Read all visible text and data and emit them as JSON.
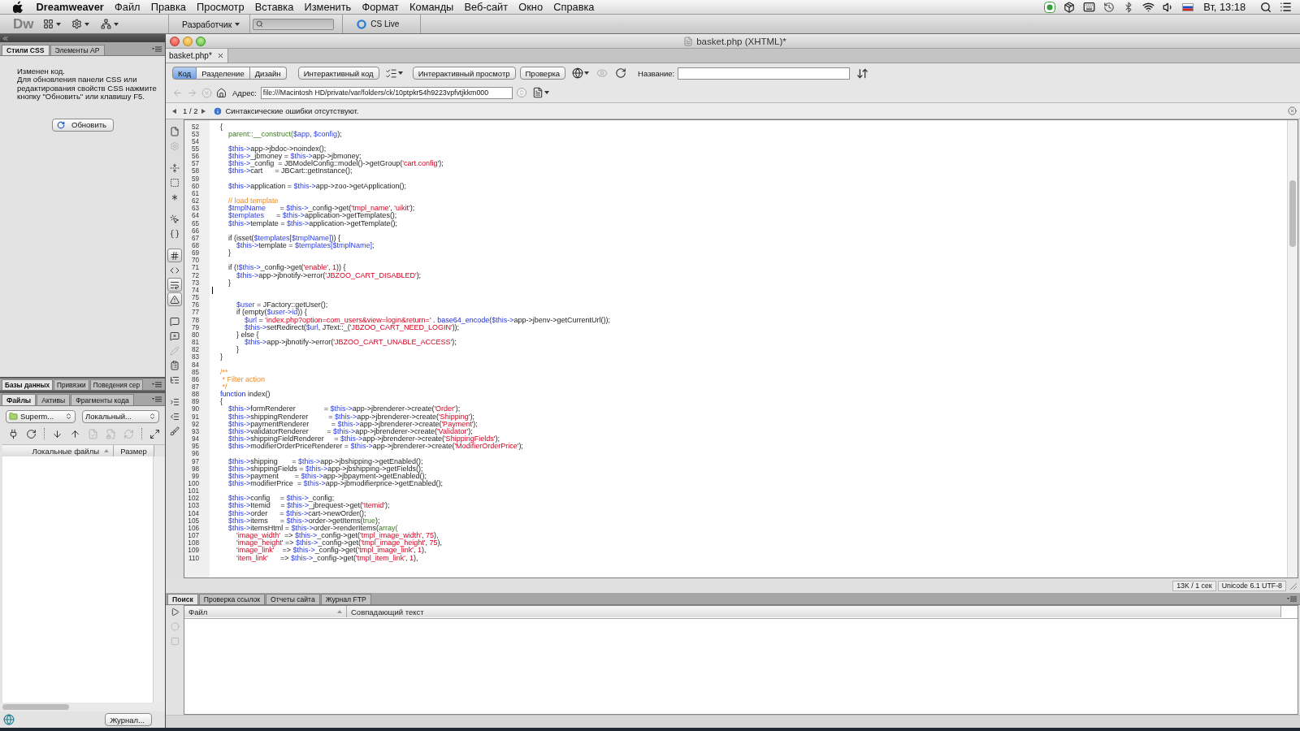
{
  "menu_bar": {
    "app_name": "Dreamweaver",
    "items": [
      "Файл",
      "Правка",
      "Просмотр",
      "Вставка",
      "Изменить",
      "Формат",
      "Команды",
      "Веб-сайт",
      "Окно",
      "Справка"
    ],
    "clock": "Вт, 13:18"
  },
  "app_bar": {
    "logo": "Dw",
    "workspace": "Разработчик",
    "cs_live": "CS Live"
  },
  "css_panel": {
    "tabs": [
      {
        "label": "Стили CSS",
        "selected": true
      },
      {
        "label": "Элементы AP",
        "selected": false
      }
    ],
    "status": "Изменен код.",
    "message": "Для обновления панели CSS или редактирования свойств CSS нажмите кнопку \"Обновить\" или клавишу F5.",
    "refresh_button": "Обновить"
  },
  "data_panel": {
    "tabs": [
      {
        "label": "Базы данных",
        "selected": true
      },
      {
        "label": "Привязки",
        "selected": false
      },
      {
        "label": "Поведения сер",
        "selected": false
      }
    ]
  },
  "files_panel": {
    "tabs": [
      {
        "label": "Файлы",
        "selected": true
      },
      {
        "label": "Активы",
        "selected": false
      },
      {
        "label": "Фрагменты кода",
        "selected": false
      }
    ],
    "site": "Superm...",
    "view": "Локальный...",
    "tools": [
      {
        "disabled": false
      },
      {
        "disabled": false
      },
      {
        "disabled": false
      },
      {
        "disabled": false
      },
      {
        "disabled": true
      },
      {
        "disabled": true
      },
      {
        "disabled": true
      },
      {
        "disabled": false
      }
    ],
    "columns": [
      {
        "label": "Локальные файлы",
        "sorted": true
      },
      {
        "label": "Размер",
        "sorted": false
      }
    ],
    "log_button": "Журнал..."
  },
  "document": {
    "title": "basket.php (XHTML)*",
    "tab": "basket.php*",
    "views": [
      {
        "label": "Код",
        "selected": true
      },
      {
        "label": "Разделение",
        "selected": false
      },
      {
        "label": "Дизайн",
        "selected": false
      }
    ],
    "live_code_button": "Интерактивный код",
    "live_view_button": "Интерактивный просмотр",
    "inspect_button": "Проверка",
    "preview_tools": [
      {
        "disabled": false
      },
      {
        "disabled": true
      },
      {
        "disabled": false
      }
    ],
    "title_label": "Название:",
    "nav_tools": [
      {
        "disabled": true
      },
      {
        "disabled": true
      },
      {
        "disabled": true
      },
      {
        "disabled": false
      }
    ],
    "address_label": "Адрес:",
    "address": "file:///Macintosh HD/private/var/folders/ck/10ptpkr54h9223vpfvtjkkm000",
    "page": "1 / 2",
    "info": "Синтаксические ошибки отсутствуют."
  },
  "coding_tools": [
    {
      "pressed": false,
      "disabled": false
    },
    {
      "pressed": false,
      "disabled": true
    },
    {
      "pressed": false,
      "disabled": false
    },
    {
      "pressed": false,
      "disabled": false
    },
    {
      "pressed": false,
      "disabled": false
    },
    {
      "pressed": false,
      "disabled": false
    },
    {
      "pressed": false,
      "disabled": false
    },
    {
      "pressed": true,
      "disabled": false
    },
    {
      "pressed": false,
      "disabled": false
    },
    {
      "pressed": true,
      "disabled": false
    },
    {
      "pressed": true,
      "disabled": false
    },
    {
      "pressed": false,
      "disabled": false
    },
    {
      "pressed": false,
      "disabled": false
    },
    {
      "pressed": false,
      "disabled": true
    },
    {
      "pressed": false,
      "disabled": false
    },
    {
      "pressed": false,
      "disabled": false
    },
    {
      "pressed": false,
      "disabled": false
    },
    {
      "pressed": false,
      "disabled": false
    },
    {
      "pressed": false,
      "disabled": false
    }
  ],
  "editor": {
    "lines": [
      {
        "number": "52",
        "caret": false,
        "tokens": [
          {
            "kind": "plain",
            "text": "\t{"
          }
        ]
      },
      {
        "number": "53",
        "caret": false,
        "tokens": [
          {
            "kind": "builtin",
            "text": "\t\tparent::__construct("
          },
          {
            "kind": "variable",
            "text": "$app"
          },
          {
            "kind": "plain",
            "text": ", "
          },
          {
            "kind": "variable",
            "text": "$config"
          },
          {
            "kind": "plain",
            "text": ");"
          }
        ]
      },
      {
        "number": "54",
        "caret": false
      },
      {
        "number": "55",
        "caret": false,
        "tokens": [
          {
            "kind": "variable",
            "text": "\t\t$this->"
          },
          {
            "kind": "plain",
            "text": "app->jbdoc->noindex();"
          }
        ]
      },
      {
        "number": "56",
        "caret": false,
        "tokens": [
          {
            "kind": "variable",
            "text": "\t\t$this->"
          },
          {
            "kind": "plain",
            "text": "_jbmoney = "
          },
          {
            "kind": "variable",
            "text": "$this->"
          },
          {
            "kind": "plain",
            "text": "app->jbmoney;"
          }
        ]
      },
      {
        "number": "57",
        "caret": false,
        "tokens": [
          {
            "kind": "variable",
            "text": "\t\t$this->"
          },
          {
            "kind": "plain",
            "text": "_config  = JBModelConfig::model()->getGroup("
          },
          {
            "kind": "string",
            "text": "'cart.config'"
          },
          {
            "kind": "plain",
            "text": ");"
          }
        ]
      },
      {
        "number": "58",
        "caret": false,
        "tokens": [
          {
            "kind": "variable",
            "text": "\t\t$this->"
          },
          {
            "kind": "plain",
            "text": "cart      = JBCart::getInstance();"
          }
        ]
      },
      {
        "number": "59",
        "caret": false
      },
      {
        "number": "60",
        "caret": false,
        "tokens": [
          {
            "kind": "variable",
            "text": "\t\t$this->"
          },
          {
            "kind": "plain",
            "text": "application = "
          },
          {
            "kind": "variable",
            "text": "$this->"
          },
          {
            "kind": "plain",
            "text": "app->zoo->getApplication();"
          }
        ]
      },
      {
        "number": "61",
        "caret": false
      },
      {
        "number": "62",
        "caret": false,
        "tokens": [
          {
            "kind": "comment",
            "text": "\t\t// load template"
          }
        ]
      },
      {
        "number": "63",
        "caret": false,
        "tokens": [
          {
            "kind": "variable",
            "text": "\t\t$tmplName"
          },
          {
            "kind": "plain",
            "text": "       = "
          },
          {
            "kind": "variable",
            "text": "$this->"
          },
          {
            "kind": "plain",
            "text": "_config->get("
          },
          {
            "kind": "string",
            "text": "'tmpl_name'"
          },
          {
            "kind": "plain",
            "text": ", "
          },
          {
            "kind": "string",
            "text": "'uikit'"
          },
          {
            "kind": "plain",
            "text": ");"
          }
        ]
      },
      {
        "number": "64",
        "caret": false,
        "tokens": [
          {
            "kind": "variable",
            "text": "\t\t$templates"
          },
          {
            "kind": "plain",
            "text": "      = "
          },
          {
            "kind": "variable",
            "text": "$this->"
          },
          {
            "kind": "plain",
            "text": "application->getTemplates();"
          }
        ]
      },
      {
        "number": "65",
        "caret": false,
        "tokens": [
          {
            "kind": "variable",
            "text": "\t\t$this->"
          },
          {
            "kind": "plain",
            "text": "template = "
          },
          {
            "kind": "variable",
            "text": "$this->"
          },
          {
            "kind": "plain",
            "text": "application->getTemplate();"
          }
        ]
      },
      {
        "number": "66",
        "caret": false
      },
      {
        "number": "67",
        "caret": false,
        "tokens": [
          {
            "kind": "plain",
            "text": "\t\tif (isset("
          },
          {
            "kind": "variable",
            "text": "$templates[$tmplName]"
          },
          {
            "kind": "plain",
            "text": ")) {"
          }
        ]
      },
      {
        "number": "68",
        "caret": false,
        "tokens": [
          {
            "kind": "variable",
            "text": "\t\t\t$this->"
          },
          {
            "kind": "plain",
            "text": "template = "
          },
          {
            "kind": "variable",
            "text": "$templates[$tmplName]"
          },
          {
            "kind": "plain",
            "text": ";"
          }
        ]
      },
      {
        "number": "69",
        "caret": false,
        "tokens": [
          {
            "kind": "plain",
            "text": "\t\t}"
          }
        ]
      },
      {
        "number": "70",
        "caret": false
      },
      {
        "number": "71",
        "caret": false,
        "tokens": [
          {
            "kind": "plain",
            "text": "\t\tif (!"
          },
          {
            "kind": "variable",
            "text": "$this->"
          },
          {
            "kind": "plain",
            "text": "_config->get("
          },
          {
            "kind": "string",
            "text": "'enable'"
          },
          {
            "kind": "plain",
            "text": ", "
          },
          {
            "kind": "number",
            "text": "1"
          },
          {
            "kind": "plain",
            "text": ")) {"
          }
        ]
      },
      {
        "number": "72",
        "caret": false,
        "tokens": [
          {
            "kind": "variable",
            "text": "\t\t\t$this->"
          },
          {
            "kind": "plain",
            "text": "app->jbnotify->error("
          },
          {
            "kind": "string",
            "text": "'JBZOO_CART_DISABLED'"
          },
          {
            "kind": "plain",
            "text": ");"
          }
        ]
      },
      {
        "number": "73",
        "caret": false,
        "tokens": [
          {
            "kind": "plain",
            "text": "\t\t}"
          }
        ]
      },
      {
        "number": "74",
        "caret": true
      },
      {
        "number": "75",
        "caret": false
      },
      {
        "number": "76",
        "caret": false,
        "tokens": [
          {
            "kind": "variable",
            "text": "\t\t\t$user"
          },
          {
            "kind": "plain",
            "text": " = JFactory::getUser();"
          }
        ]
      },
      {
        "number": "77",
        "caret": false,
        "tokens": [
          {
            "kind": "plain",
            "text": "\t\t\tif (empty("
          },
          {
            "kind": "variable",
            "text": "$user->id"
          },
          {
            "kind": "plain",
            "text": ")) {"
          }
        ]
      },
      {
        "number": "78",
        "caret": false,
        "tokens": [
          {
            "kind": "variable",
            "text": "\t\t\t\t$url"
          },
          {
            "kind": "plain",
            "text": " = "
          },
          {
            "kind": "string",
            "text": "'index.php?option=com_users&view=login&return='"
          },
          {
            "kind": "plain",
            "text": " . "
          },
          {
            "kind": "keyword",
            "text": "base64_encode("
          },
          {
            "kind": "variable",
            "text": "$this->"
          },
          {
            "kind": "plain",
            "text": "app->jbenv->getCurrentUrl());"
          }
        ]
      },
      {
        "number": "79",
        "caret": false,
        "tokens": [
          {
            "kind": "variable",
            "text": "\t\t\t\t$this->"
          },
          {
            "kind": "plain",
            "text": "setRedirect("
          },
          {
            "kind": "variable",
            "text": "$url"
          },
          {
            "kind": "plain",
            "text": ", JText::_("
          },
          {
            "kind": "string",
            "text": "'JBZOO_CART_NEED_LOGIN'"
          },
          {
            "kind": "plain",
            "text": "));"
          }
        ]
      },
      {
        "number": "80",
        "caret": false,
        "tokens": [
          {
            "kind": "plain",
            "text": "\t\t\t} else {"
          }
        ]
      },
      {
        "number": "81",
        "caret": false,
        "tokens": [
          {
            "kind": "variable",
            "text": "\t\t\t\t$this->"
          },
          {
            "kind": "plain",
            "text": "app->jbnotify->error("
          },
          {
            "kind": "string",
            "text": "'JBZOO_CART_UNABLE_ACCESS'"
          },
          {
            "kind": "plain",
            "text": ");"
          }
        ]
      },
      {
        "number": "82",
        "caret": false,
        "tokens": [
          {
            "kind": "plain",
            "text": "\t\t\t}"
          }
        ]
      },
      {
        "number": "83",
        "caret": false,
        "tokens": [
          {
            "kind": "plain",
            "text": "\t}"
          }
        ]
      },
      {
        "number": "84",
        "caret": false
      },
      {
        "number": "85",
        "caret": false,
        "tokens": [
          {
            "kind": "comment",
            "text": "\t/**"
          }
        ]
      },
      {
        "number": "86",
        "caret": false,
        "tokens": [
          {
            "kind": "comment",
            "text": "\t * Filter action"
          }
        ]
      },
      {
        "number": "87",
        "caret": false,
        "tokens": [
          {
            "kind": "comment",
            "text": "\t */"
          }
        ]
      },
      {
        "number": "88",
        "caret": false,
        "tokens": [
          {
            "kind": "keyword",
            "text": "\tfunction"
          },
          {
            "kind": "plain",
            "text": " index()"
          }
        ]
      },
      {
        "number": "89",
        "caret": false,
        "tokens": [
          {
            "kind": "plain",
            "text": "\t{"
          }
        ]
      },
      {
        "number": "90",
        "caret": false,
        "tokens": [
          {
            "kind": "variable",
            "text": "\t\t$this->"
          },
          {
            "kind": "plain",
            "text": "formRenderer              = "
          },
          {
            "kind": "variable",
            "text": "$this->"
          },
          {
            "kind": "plain",
            "text": "app->jbrenderer->create("
          },
          {
            "kind": "string",
            "text": "'Order'"
          },
          {
            "kind": "plain",
            "text": ");"
          }
        ]
      },
      {
        "number": "91",
        "caret": false,
        "tokens": [
          {
            "kind": "variable",
            "text": "\t\t$this->"
          },
          {
            "kind": "plain",
            "text": "shippingRenderer          = "
          },
          {
            "kind": "variable",
            "text": "$this->"
          },
          {
            "kind": "plain",
            "text": "app->jbrenderer->create("
          },
          {
            "kind": "string",
            "text": "'Shipping'"
          },
          {
            "kind": "plain",
            "text": ");"
          }
        ]
      },
      {
        "number": "92",
        "caret": false,
        "tokens": [
          {
            "kind": "variable",
            "text": "\t\t$this->"
          },
          {
            "kind": "plain",
            "text": "paymentRenderer           = "
          },
          {
            "kind": "variable",
            "text": "$this->"
          },
          {
            "kind": "plain",
            "text": "app->jbrenderer->create("
          },
          {
            "kind": "string",
            "text": "'Payment'"
          },
          {
            "kind": "plain",
            "text": ");"
          }
        ]
      },
      {
        "number": "93",
        "caret": false,
        "tokens": [
          {
            "kind": "variable",
            "text": "\t\t$this->"
          },
          {
            "kind": "plain",
            "text": "validatorRenderer         = "
          },
          {
            "kind": "variable",
            "text": "$this->"
          },
          {
            "kind": "plain",
            "text": "app->jbrenderer->create("
          },
          {
            "kind": "string",
            "text": "'Validator'"
          },
          {
            "kind": "plain",
            "text": ");"
          }
        ]
      },
      {
        "number": "94",
        "caret": false,
        "tokens": [
          {
            "kind": "variable",
            "text": "\t\t$this->"
          },
          {
            "kind": "plain",
            "text": "shippingFieldRenderer     = "
          },
          {
            "kind": "variable",
            "text": "$this->"
          },
          {
            "kind": "plain",
            "text": "app->jbrenderer->create("
          },
          {
            "kind": "string",
            "text": "'ShippingFields'"
          },
          {
            "kind": "plain",
            "text": ");"
          }
        ]
      },
      {
        "number": "95",
        "caret": false,
        "tokens": [
          {
            "kind": "variable",
            "text": "\t\t$this->"
          },
          {
            "kind": "plain",
            "text": "modifierOrderPriceRenderer = "
          },
          {
            "kind": "variable",
            "text": "$this->"
          },
          {
            "kind": "plain",
            "text": "app->jbrenderer->create("
          },
          {
            "kind": "string",
            "text": "'ModifierOrderPrice'"
          },
          {
            "kind": "plain",
            "text": ");"
          }
        ]
      },
      {
        "number": "96",
        "caret": false
      },
      {
        "number": "97",
        "caret": false,
        "tokens": [
          {
            "kind": "variable",
            "text": "\t\t$this->"
          },
          {
            "kind": "plain",
            "text": "shipping       = "
          },
          {
            "kind": "variable",
            "text": "$this->"
          },
          {
            "kind": "plain",
            "text": "app->jbshipping->getEnabled();"
          }
        ]
      },
      {
        "number": "98",
        "caret": false,
        "tokens": [
          {
            "kind": "variable",
            "text": "\t\t$this->"
          },
          {
            "kind": "plain",
            "text": "shippingFields = "
          },
          {
            "kind": "variable",
            "text": "$this->"
          },
          {
            "kind": "plain",
            "text": "app->jbshipping->getFields();"
          }
        ]
      },
      {
        "number": "99",
        "caret": false,
        "tokens": [
          {
            "kind": "variable",
            "text": "\t\t$this->"
          },
          {
            "kind": "plain",
            "text": "payment        = "
          },
          {
            "kind": "variable",
            "text": "$this->"
          },
          {
            "kind": "plain",
            "text": "app->jbpayment->getEnabled();"
          }
        ]
      },
      {
        "number": "100",
        "caret": false,
        "tokens": [
          {
            "kind": "variable",
            "text": "\t\t$this->"
          },
          {
            "kind": "plain",
            "text": "modifierPrice  = "
          },
          {
            "kind": "variable",
            "text": "$this->"
          },
          {
            "kind": "plain",
            "text": "app->jbmodifierprice->getEnabled();"
          }
        ]
      },
      {
        "number": "101",
        "caret": false
      },
      {
        "number": "102",
        "caret": false,
        "tokens": [
          {
            "kind": "variable",
            "text": "\t\t$this->"
          },
          {
            "kind": "plain",
            "text": "config     = "
          },
          {
            "kind": "variable",
            "text": "$this->"
          },
          {
            "kind": "plain",
            "text": "_config;"
          }
        ]
      },
      {
        "number": "103",
        "caret": false,
        "tokens": [
          {
            "kind": "variable",
            "text": "\t\t$this->"
          },
          {
            "kind": "plain",
            "text": "Itemid     = "
          },
          {
            "kind": "variable",
            "text": "$this->"
          },
          {
            "kind": "plain",
            "text": "_jbrequest->get("
          },
          {
            "kind": "string",
            "text": "'Itemid'"
          },
          {
            "kind": "plain",
            "text": ");"
          }
        ]
      },
      {
        "number": "104",
        "caret": false,
        "tokens": [
          {
            "kind": "variable",
            "text": "\t\t$this->"
          },
          {
            "kind": "plain",
            "text": "order      = "
          },
          {
            "kind": "variable",
            "text": "$this->"
          },
          {
            "kind": "plain",
            "text": "cart->newOrder();"
          }
        ]
      },
      {
        "number": "105",
        "caret": false,
        "tokens": [
          {
            "kind": "variable",
            "text": "\t\t$this->"
          },
          {
            "kind": "plain",
            "text": "items      = "
          },
          {
            "kind": "variable",
            "text": "$this->"
          },
          {
            "kind": "plain",
            "text": "order->getItems("
          },
          {
            "kind": "builtin",
            "text": "true"
          },
          {
            "kind": "plain",
            "text": ");"
          }
        ]
      },
      {
        "number": "106",
        "caret": false,
        "tokens": [
          {
            "kind": "variable",
            "text": "\t\t$this->"
          },
          {
            "kind": "plain",
            "text": "itemsHtml = "
          },
          {
            "kind": "variable",
            "text": "$this->"
          },
          {
            "kind": "plain",
            "text": "order->renderItems("
          },
          {
            "kind": "builtin",
            "text": "array("
          }
        ]
      },
      {
        "number": "107",
        "caret": false,
        "tokens": [
          {
            "kind": "string",
            "text": "\t\t\t'image_width'"
          },
          {
            "kind": "plain",
            "text": "  => "
          },
          {
            "kind": "variable",
            "text": "$this->"
          },
          {
            "kind": "plain",
            "text": "_config->get("
          },
          {
            "kind": "string",
            "text": "'tmpl_image_width'"
          },
          {
            "kind": "plain",
            "text": ", "
          },
          {
            "kind": "number",
            "text": "75"
          },
          {
            "kind": "plain",
            "text": "),"
          }
        ]
      },
      {
        "number": "108",
        "caret": false,
        "tokens": [
          {
            "kind": "string",
            "text": "\t\t\t'image_height'"
          },
          {
            "kind": "plain",
            "text": " => "
          },
          {
            "kind": "variable",
            "text": "$this->"
          },
          {
            "kind": "plain",
            "text": "_config->get("
          },
          {
            "kind": "string",
            "text": "'tmpl_image_height'"
          },
          {
            "kind": "plain",
            "text": ", "
          },
          {
            "kind": "number",
            "text": "75"
          },
          {
            "kind": "plain",
            "text": "),"
          }
        ]
      },
      {
        "number": "109",
        "caret": false,
        "tokens": [
          {
            "kind": "string",
            "text": "\t\t\t'image_link'"
          },
          {
            "kind": "plain",
            "text": "    => "
          },
          {
            "kind": "variable",
            "text": "$this->"
          },
          {
            "kind": "plain",
            "text": "_config->get("
          },
          {
            "kind": "string",
            "text": "'tmpl_image_link'"
          },
          {
            "kind": "plain",
            "text": ", "
          },
          {
            "kind": "number",
            "text": "1"
          },
          {
            "kind": "plain",
            "text": "),"
          }
        ]
      },
      {
        "number": "110",
        "caret": false,
        "tokens": [
          {
            "kind": "string",
            "text": "\t\t\t'item_link'"
          },
          {
            "kind": "plain",
            "text": "      => "
          },
          {
            "kind": "variable",
            "text": "$this->"
          },
          {
            "kind": "plain",
            "text": "_config->get("
          },
          {
            "kind": "string",
            "text": "'tmpl_item_link'"
          },
          {
            "kind": "plain",
            "text": ", "
          },
          {
            "kind": "number",
            "text": "1"
          },
          {
            "kind": "plain",
            "text": "),"
          }
        ]
      }
    ]
  },
  "status_bar": {
    "size": "13K / 1 сек",
    "encoding": "Unicode 6.1 UTF-8"
  },
  "results_panel": {
    "tabs": [
      {
        "label": "Поиск",
        "selected": true
      },
      {
        "label": "Проверка ссылок",
        "selected": false
      },
      {
        "label": "Отчеты сайта",
        "selected": false
      },
      {
        "label": "Журнал FTP",
        "selected": false
      }
    ],
    "tools": [
      {
        "disabled": false
      },
      {
        "disabled": true
      },
      {
        "disabled": true
      }
    ],
    "columns": [
      {
        "label": "Файл",
        "sorted": true
      },
      {
        "label": "Совпадающий текст",
        "sorted": false
      }
    ]
  }
}
